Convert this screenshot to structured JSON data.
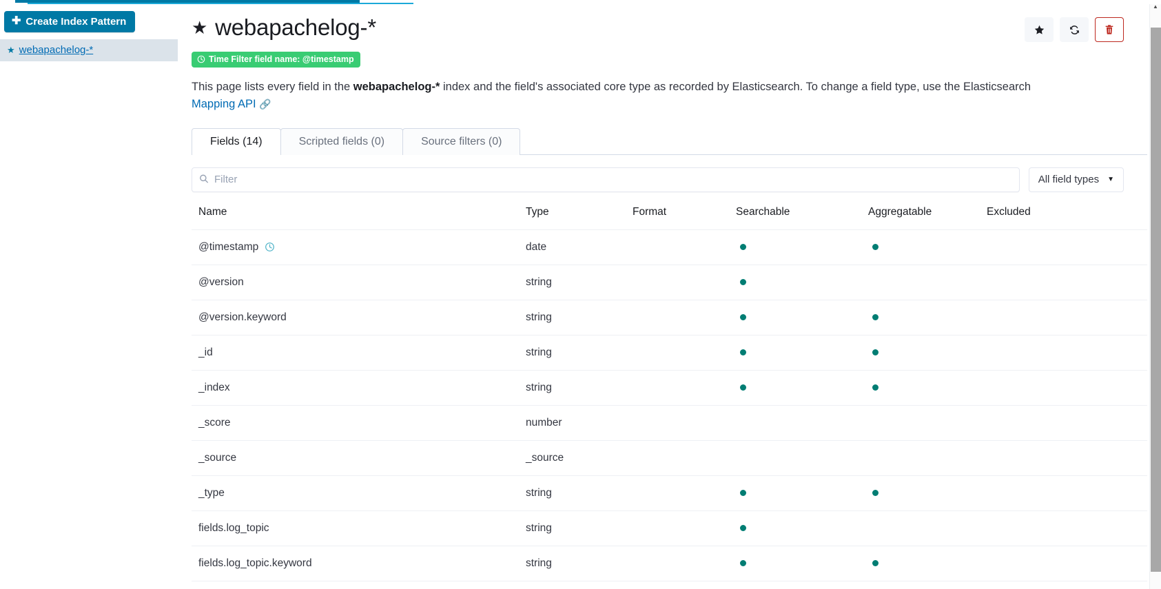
{
  "sidebar": {
    "create_button": {
      "label": "Create Index Pattern",
      "icon": "plus-icon"
    },
    "patterns": [
      {
        "label": "webapachelog-*",
        "icon": "star-icon",
        "selected": true
      }
    ]
  },
  "header": {
    "title": "webapachelog-*",
    "title_icon": "star-icon",
    "actions": [
      {
        "name": "set-default-index-button",
        "icon": "star-icon",
        "style": "plain"
      },
      {
        "name": "refresh-fields-button",
        "icon": "refresh-icon",
        "style": "plain"
      },
      {
        "name": "delete-index-pattern-button",
        "icon": "trash-icon",
        "style": "danger"
      }
    ],
    "time_badge": {
      "icon": "clock-icon",
      "text": "Time Filter field name: @timestamp"
    },
    "description": {
      "part1": "This page lists every field in the ",
      "bold": "webapachelog-*",
      "part2": " index and the field's associated core type as recorded by Elasticsearch. To change a field type, use the Elasticsearch ",
      "link": "Mapping API",
      "link_icon": "external-link-icon"
    }
  },
  "tabs": [
    {
      "label": "Fields (14)",
      "active": true
    },
    {
      "label": "Scripted fields (0)",
      "active": false
    },
    {
      "label": "Source filters (0)",
      "active": false
    }
  ],
  "filter": {
    "placeholder": "Filter",
    "value": "",
    "icon": "search-icon",
    "field_types_label": "All field types",
    "field_types_icon": "chevron-down-icon"
  },
  "table": {
    "columns": [
      "Name",
      "Type",
      "Format",
      "Searchable",
      "Aggregatable",
      "Excluded"
    ],
    "rows": [
      {
        "name": "@timestamp",
        "icon": "clock-icon",
        "type": "date",
        "format": "",
        "searchable": true,
        "aggregatable": true,
        "excluded": ""
      },
      {
        "name": "@version",
        "icon": "",
        "type": "string",
        "format": "",
        "searchable": true,
        "aggregatable": false,
        "excluded": ""
      },
      {
        "name": "@version.keyword",
        "icon": "",
        "type": "string",
        "format": "",
        "searchable": true,
        "aggregatable": true,
        "excluded": ""
      },
      {
        "name": "_id",
        "icon": "",
        "type": "string",
        "format": "",
        "searchable": true,
        "aggregatable": true,
        "excluded": ""
      },
      {
        "name": "_index",
        "icon": "",
        "type": "string",
        "format": "",
        "searchable": true,
        "aggregatable": true,
        "excluded": ""
      },
      {
        "name": "_score",
        "icon": "",
        "type": "number",
        "format": "",
        "searchable": false,
        "aggregatable": false,
        "excluded": ""
      },
      {
        "name": "_source",
        "icon": "",
        "type": "_source",
        "format": "",
        "searchable": false,
        "aggregatable": false,
        "excluded": ""
      },
      {
        "name": "_type",
        "icon": "",
        "type": "string",
        "format": "",
        "searchable": true,
        "aggregatable": true,
        "excluded": ""
      },
      {
        "name": "fields.log_topic",
        "icon": "",
        "type": "string",
        "format": "",
        "searchable": true,
        "aggregatable": false,
        "excluded": ""
      },
      {
        "name": "fields.log_topic.keyword",
        "icon": "",
        "type": "string",
        "format": "",
        "searchable": true,
        "aggregatable": true,
        "excluded": ""
      }
    ]
  },
  "colors": {
    "primary": "#0079a5",
    "link": "#006bb4",
    "badge_green": "#39cc73",
    "dot_teal": "#017d73",
    "danger": "#bd271e"
  }
}
